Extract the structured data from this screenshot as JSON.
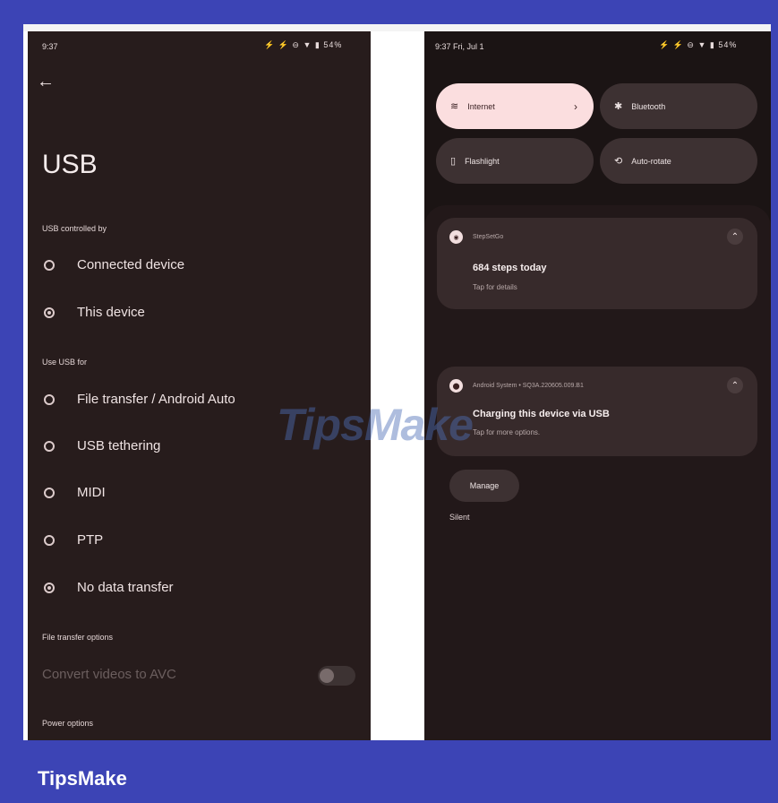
{
  "left_screen": {
    "status_time": "9:37",
    "status_icons": "⚡ ⚡ ⊖ ▼ ▮ 54%",
    "back_arrow": "←",
    "title": "USB",
    "section_controlled": "USB controlled by",
    "controlled_options": [
      {
        "label": "Connected device",
        "selected": false
      },
      {
        "label": "This device",
        "selected": true
      }
    ],
    "section_use": "Use USB for",
    "use_options": [
      {
        "label": "File transfer / Android Auto",
        "selected": false
      },
      {
        "label": "USB tethering",
        "selected": false
      },
      {
        "label": "MIDI",
        "selected": false
      },
      {
        "label": "PTP",
        "selected": false
      },
      {
        "label": "No data transfer",
        "selected": true
      }
    ],
    "section_file_transfer": "File transfer options",
    "convert_videos_label": "Convert videos to AVC",
    "convert_videos_enabled": false,
    "section_power": "Power options"
  },
  "right_screen": {
    "status_time": "9:37 Fri, Jul 1",
    "status_icons": "⚡ ⚡ ⊖ ▼ ▮ 54%",
    "tiles": [
      {
        "label": "Internet",
        "icon": "wifi-icon",
        "active": true,
        "chevron": "›"
      },
      {
        "label": "Bluetooth",
        "icon": "bluetooth-icon",
        "active": false
      },
      {
        "label": "Flashlight",
        "icon": "flashlight-icon",
        "active": false
      },
      {
        "label": "Auto-rotate",
        "icon": "rotate-icon",
        "active": false
      }
    ],
    "notification1": {
      "app": "StepSetGo",
      "title": "684 steps today",
      "subtitle": "Tap for details"
    },
    "silent_label": "Silent",
    "notification2": {
      "app": "Android System • SQ3A.220605.009.B1",
      "title": "Charging this device via USB",
      "subtitle": "Tap for more options."
    },
    "manage_label": "Manage"
  },
  "watermark": "TipsMake",
  "brand_footer": "TipsMake",
  "colors": {
    "background": "#3c44b5",
    "phone_bg": "#271c1c",
    "active_tile": "#fbdedf"
  }
}
